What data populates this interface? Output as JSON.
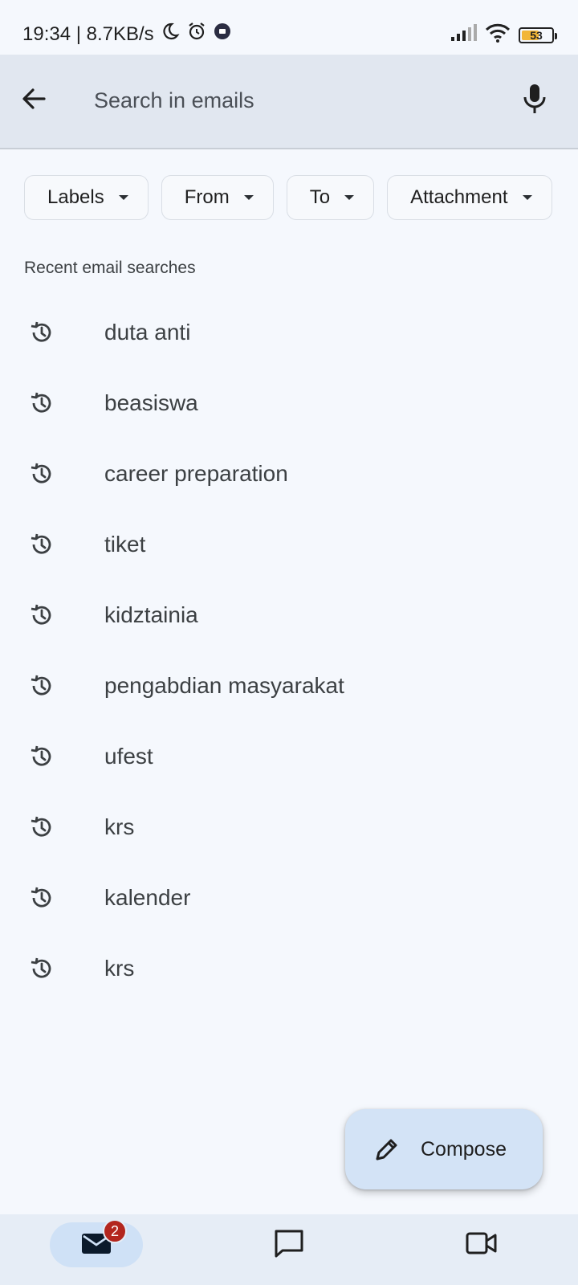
{
  "status_bar": {
    "time_speed": "19:34 | 8.7KB/s",
    "icons": [
      "moon-icon",
      "alarm-icon",
      "notification-app-icon"
    ],
    "right_icons": [
      "signal-icon",
      "wifi-icon",
      "battery-icon"
    ],
    "battery_level": "53",
    "battery_color": "#f2b637"
  },
  "search": {
    "placeholder": "Search in emails",
    "value": ""
  },
  "filters": [
    {
      "label": "Labels"
    },
    {
      "label": "From"
    },
    {
      "label": "To"
    },
    {
      "label": "Attachment"
    }
  ],
  "recent": {
    "heading": "Recent email searches",
    "items": [
      "duta anti",
      "beasiswa",
      "career preparation",
      "tiket",
      "kidztainia",
      "pengabdian masyarakat",
      "ufest",
      "krs",
      "kalender",
      "krs"
    ]
  },
  "compose": {
    "label": "Compose"
  },
  "bottom_nav": {
    "mail_badge": "2",
    "items": [
      "mail-icon",
      "chat-icon",
      "meet-icon"
    ]
  },
  "colors": {
    "background": "#f5f8fd",
    "header": "#e1e7f0",
    "fab": "#d3e3f6",
    "badge": "#b3261e"
  }
}
